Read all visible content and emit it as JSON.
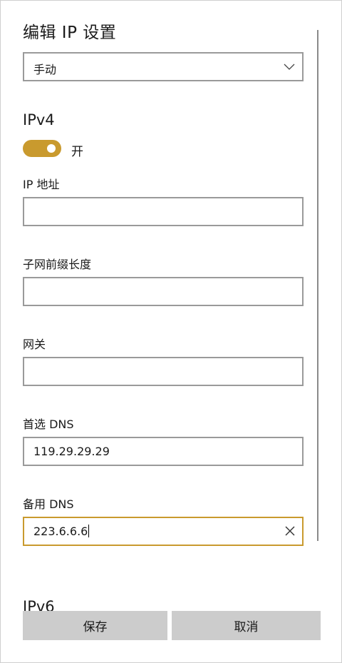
{
  "title": "编辑 IP 设置",
  "mode_select": {
    "value": "手动",
    "icon": "chevron-down-icon"
  },
  "ipv4": {
    "heading": "IPv4",
    "toggle": {
      "on": true,
      "label": "开"
    },
    "fields": {
      "ip_address": {
        "label": "IP 地址",
        "value": ""
      },
      "subnet_prefix": {
        "label": "子网前缀长度",
        "value": ""
      },
      "gateway": {
        "label": "网关",
        "value": ""
      },
      "preferred_dns": {
        "label": "首选 DNS",
        "value": "119.29.29.29"
      },
      "alternate_dns": {
        "label": "备用 DNS",
        "value": "223.6.6.6"
      }
    }
  },
  "ipv6": {
    "heading": "IPv6"
  },
  "buttons": {
    "save": "保存",
    "cancel": "取消"
  },
  "colors": {
    "accent": "#c99a2e",
    "button_bg": "#cccccc",
    "border": "#9a9a9a"
  }
}
